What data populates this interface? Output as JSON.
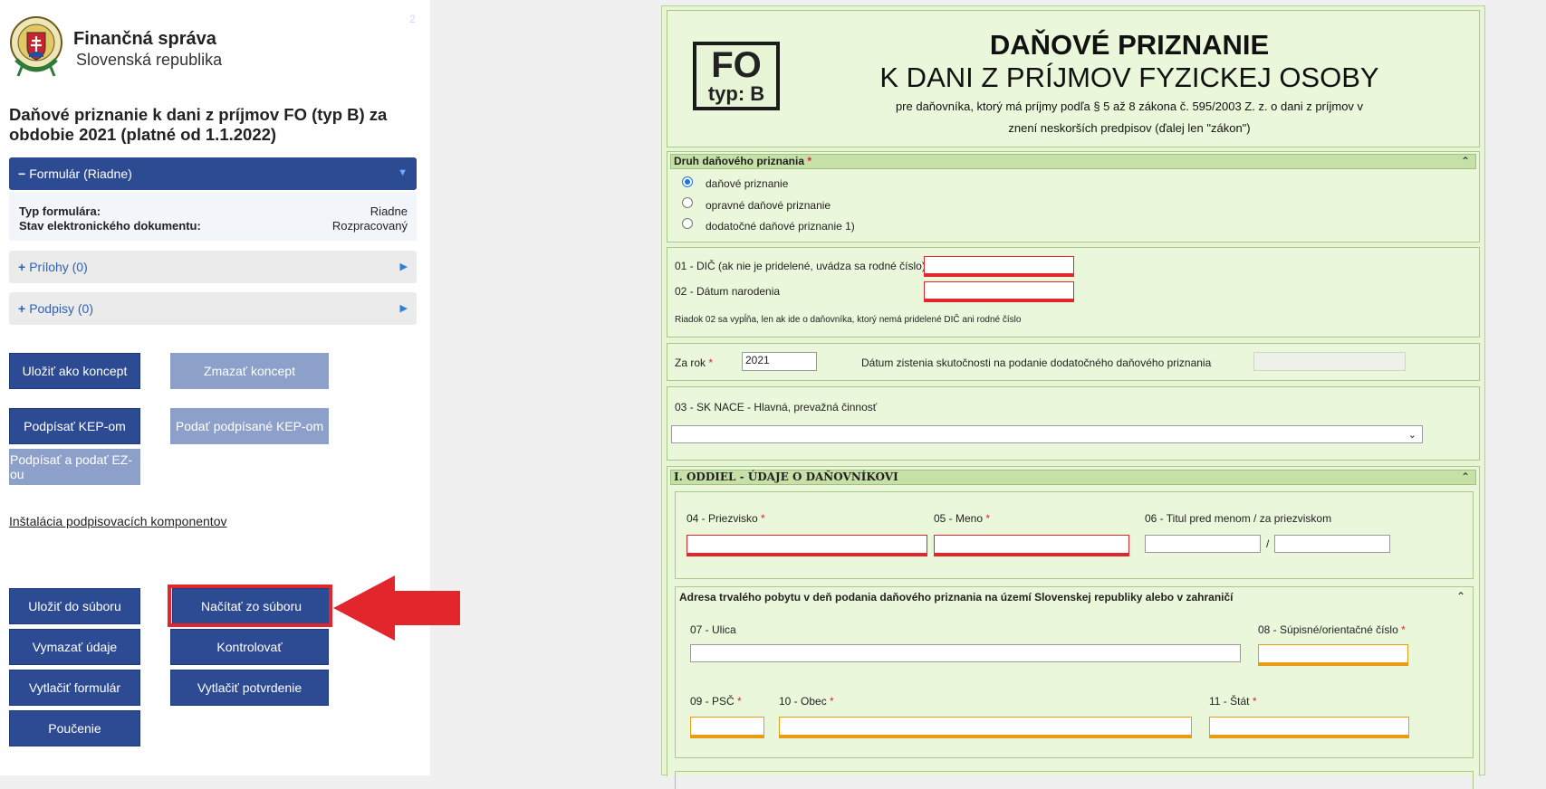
{
  "sidebar": {
    "page_num": "2",
    "org_name": "Finančná správa",
    "org_country": "Slovenská republika",
    "form_title": "Daňové priznanie k dani z príjmov FO (typ B) za obdobie 2021 (platné od 1.1.2022)",
    "accordion": {
      "formular": "Formulár (Riadne)",
      "typ_label": "Typ formulára:",
      "typ_value": "Riadne",
      "stav_label": "Stav elektronického dokumentu:",
      "stav_value": "Rozpracovaný",
      "prilohy": "Prílohy (0)",
      "podpisy": "Podpisy (0)"
    },
    "buttons": {
      "save_draft": "Uložiť ako koncept",
      "delete_draft": "Zmazať koncept",
      "sign_kep": "Podpísať KEP-om",
      "submit_kep": "Podať podpísané KEP-om",
      "sign_ez": "Podpísať a podať EZ-ou",
      "save_file": "Uložiť do súboru",
      "load_file": "Načítať zo súboru",
      "clear": "Vymazať údaje",
      "check": "Kontrolovať",
      "print_form": "Vytlačiť formulár",
      "print_confirm": "Vytlačiť potvrdenie",
      "instructions": "Poučenie"
    },
    "install_link": "Inštalácia podpisovacích komponentov"
  },
  "form": {
    "logo_line1": "FO",
    "logo_line2": "typ: B",
    "title1": "DAŇOVÉ PRIZNANIE",
    "title2": "K DANI Z PRÍJMOV FYZICKEJ OSOBY",
    "subtitle1": "pre daňovníka, ktorý má príjmy podľa § 5 až 8 zákona č. 595/2003 Z. z. o dani z príjmov v",
    "subtitle2": "znení neskorších predpisov (ďalej len \"zákon\")",
    "druh_head": "Druh daňového priznania",
    "druh_options": [
      "daňové priznanie",
      "opravné daňové priznanie",
      "dodatočné daňové priznanie 1)"
    ],
    "dic_label": "01 - DIČ (ak nie je pridelené, uvádza sa rodné číslo)",
    "datum_label": "02 - Dátum narodenia",
    "riadok_note": "Riadok 02 sa vypĺňa, len ak ide o daňovníka, ktorý nemá pridelené DIČ ani rodné číslo",
    "za_rok_label": "Za rok",
    "za_rok_value": "2021",
    "datum_zistenia_label": "Dátum zistenia skutočnosti na podanie dodatočného daňového priznania",
    "nace_label": "03 - SK NACE - Hlavná, prevažná činnosť",
    "oddiel_head": "I. ODDIEL - ÚDAJE O DAŇOVNÍKOVI",
    "priezvisko_label": "04 - Priezvisko",
    "meno_label": "05 - Meno",
    "titul_label": "06 - Titul pred menom / za priezviskom",
    "adresa_head": "Adresa trvalého pobytu v deň podania daňového priznania na území Slovenskej republiky alebo v zahraničí",
    "ulica_label": "07 - Ulica",
    "cislo_label": "08 - Súpisné/orientačné číslo",
    "psc_label": "09 - PSČ",
    "obec_label": "10 - Obec",
    "stat_label": "11 - Štát"
  }
}
